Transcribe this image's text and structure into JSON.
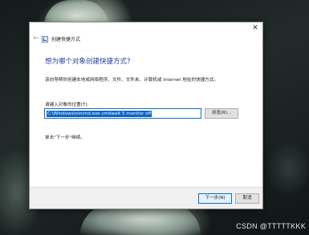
{
  "dialog": {
    "window_title": "创建快捷方式",
    "close_glyph": "✕",
    "back_glyph": "←",
    "heading": "想为哪个对象创建快捷方式?",
    "description": "该向导帮你创建本地或网络程序、文件、文件夹、计算机或 Internet 地址的快捷方式。",
    "location_label": "请键入对象的位置(T):",
    "location_value": "C:\\Windows\\nircmd.exe cmdwait 5 monitor off",
    "browse_label": "浏览(R)...",
    "hint": "单击\"下一步\"继续。",
    "next_label": "下一步(N)",
    "cancel_label": "取消"
  },
  "watermark": "CSDN @TTTTTKKK",
  "colors": {
    "heading": "#1e3f9a",
    "selection": "#0a64c7",
    "focus_border": "#0f6fc6"
  }
}
